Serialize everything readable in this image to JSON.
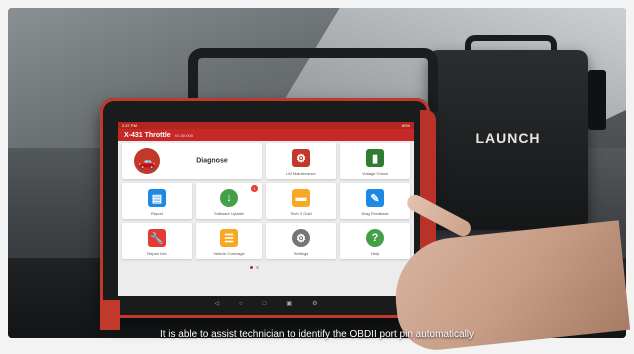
{
  "tablet": {
    "status_left": "2:47 PM",
    "status_right": "80%",
    "title": "X-431 Throttle",
    "version": "V1.00.000"
  },
  "tiles": [
    {
      "id": "diagnose",
      "label": "Diagnose",
      "icon": "car-diagnose-icon",
      "color": "#c0392b"
    },
    {
      "id": "lm",
      "label": "LM Maintenance",
      "icon": "engine-icon",
      "color": "#c0392b"
    },
    {
      "id": "voltage",
      "label": "Voltage Check",
      "icon": "battery-icon",
      "color": "#2e7d32"
    },
    {
      "id": "report",
      "label": "Report",
      "icon": "document-icon",
      "color": "#1e88e5"
    },
    {
      "id": "software",
      "label": "Software Update",
      "icon": "download-icon",
      "color": "#43a047",
      "badge": "1"
    },
    {
      "id": "tech",
      "label": "Tech 2 Gold",
      "icon": "folder-icon",
      "color": "#f9a825"
    },
    {
      "id": "feedback",
      "label": "Diag Feedback",
      "icon": "edit-icon",
      "color": "#1e88e5"
    },
    {
      "id": "repair",
      "label": "Repair Info",
      "icon": "wrench-icon",
      "color": "#e53935"
    },
    {
      "id": "coverage",
      "label": "Vehicle Coverage",
      "icon": "list-icon",
      "color": "#f9a825"
    },
    {
      "id": "settings",
      "label": "Settings",
      "icon": "gear-icon",
      "color": "#757575"
    },
    {
      "id": "help",
      "label": "Help",
      "icon": "question-icon",
      "color": "#43a047"
    }
  ],
  "vci": {
    "brand": "LAUNCH"
  },
  "caption": "It is able to assist technician to identify the OBDII port pin automatically"
}
